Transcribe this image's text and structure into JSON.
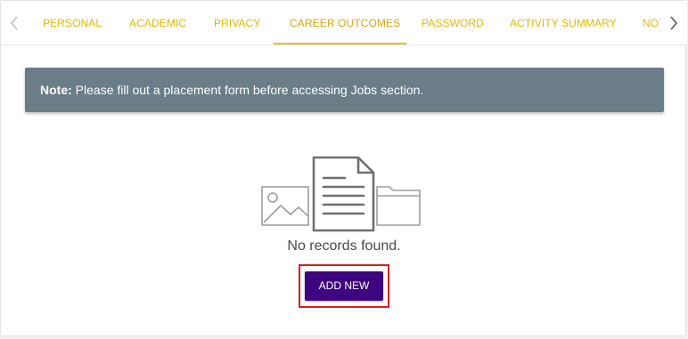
{
  "tabs": [
    {
      "label": "PERSONAL"
    },
    {
      "label": "ACADEMIC"
    },
    {
      "label": "PRIVACY"
    },
    {
      "label": "CAREER OUTCOMES",
      "active": true
    },
    {
      "label": "PASSWORD"
    },
    {
      "label": "ACTIVITY SUMMARY"
    },
    {
      "label": "NOT"
    }
  ],
  "icons": {
    "left_arrow": "chevron-left-icon",
    "right_arrow": "chevron-right-icon",
    "illustration": [
      "image-icon",
      "document-icon",
      "folder-icon"
    ]
  },
  "note": {
    "prefix": "Note:",
    "message": " Please fill out a placement form before accessing Jobs section."
  },
  "empty_state": {
    "message": "No records found."
  },
  "actions": {
    "add_new_label": "ADD NEW"
  },
  "colors": {
    "tab_text": "#e3b800",
    "tab_active_underline": "#e8be2e",
    "note_background": "#6b7d87",
    "primary_button": "#3d0680",
    "highlight_border": "#d42020"
  }
}
